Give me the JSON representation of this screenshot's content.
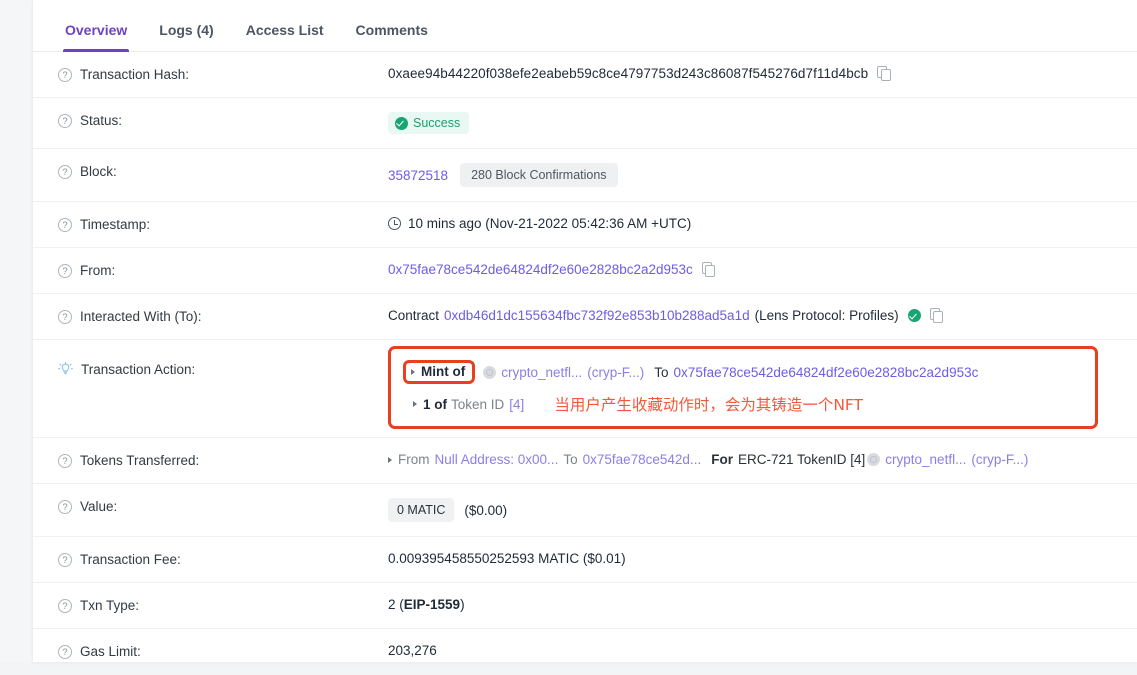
{
  "tabs": [
    {
      "label": "Overview",
      "active": true
    },
    {
      "label": "Logs (4)",
      "active": false
    },
    {
      "label": "Access List",
      "active": false
    },
    {
      "label": "Comments",
      "active": false
    }
  ],
  "rows": {
    "txn_hash": {
      "label": "Transaction Hash:",
      "value": "0xaee94b44220f038efe2eabeb59c8ce4797753d243c86087f545276d7f11d4bcb"
    },
    "status": {
      "label": "Status:",
      "badge": "Success"
    },
    "block": {
      "label": "Block:",
      "number": "35872518",
      "confirmations": "280 Block Confirmations"
    },
    "timestamp": {
      "label": "Timestamp:",
      "value": "10 mins ago (Nov-21-2022 05:42:36 AM +UTC)"
    },
    "from": {
      "label": "From:",
      "address": "0x75fae78ce542de64824df2e60e2828bc2a2d953c"
    },
    "interacted_with": {
      "label": "Interacted With (To):",
      "prefix": "Contract",
      "address": "0xdb46d1dc155634fbc732f92e853b10b288ad5a1d",
      "tag": "(Lens Protocol: Profiles)"
    },
    "transaction_action": {
      "label": "Transaction Action:",
      "mint_of": "Mint of",
      "token_name": "crypto_netfl...",
      "token_symbol": "(cryp-F...)",
      "to_word": "To",
      "to_address": "0x75fae78ce542de64824df2e60e2828bc2a2d953c",
      "amount": "1 of",
      "token_id_label": "Token ID",
      "token_id": "[4]",
      "annotation": "当用户产生收藏动作时，会为其铸造一个NFT",
      "annotation_color": "#f2593c",
      "highlight_color": "#e8401e"
    },
    "tokens_transferred": {
      "label": "Tokens Transferred:",
      "from_word": "From",
      "from_value": "Null Address: 0x00...",
      "to_word": "To",
      "to_value": "0x75fae78ce542d...",
      "for_word": "For",
      "standard": "ERC-721 TokenID [4]",
      "token_name": "crypto_netfl...",
      "token_symbol": "(cryp-F...)"
    },
    "value": {
      "label": "Value:",
      "amount": "0 MATIC",
      "fiat": "($0.00)"
    },
    "txn_fee": {
      "label": "Transaction Fee:",
      "value": "0.009395458550252593 MATIC ($0.01)"
    },
    "txn_type": {
      "label": "Txn Type:",
      "prefix": "2 (",
      "eip": "EIP-1559",
      "suffix": ")"
    },
    "gas_limit": {
      "label": "Gas Limit:",
      "value": "203,276"
    }
  },
  "icons": {
    "help": "?",
    "copy": "copy-icon",
    "verified": "verified-check-icon",
    "bulb": "lightbulb-icon"
  },
  "colors": {
    "accent": "#6f42c1",
    "link": "#6c5ce7",
    "success": "#17a673",
    "annotation": "#e8401e"
  }
}
